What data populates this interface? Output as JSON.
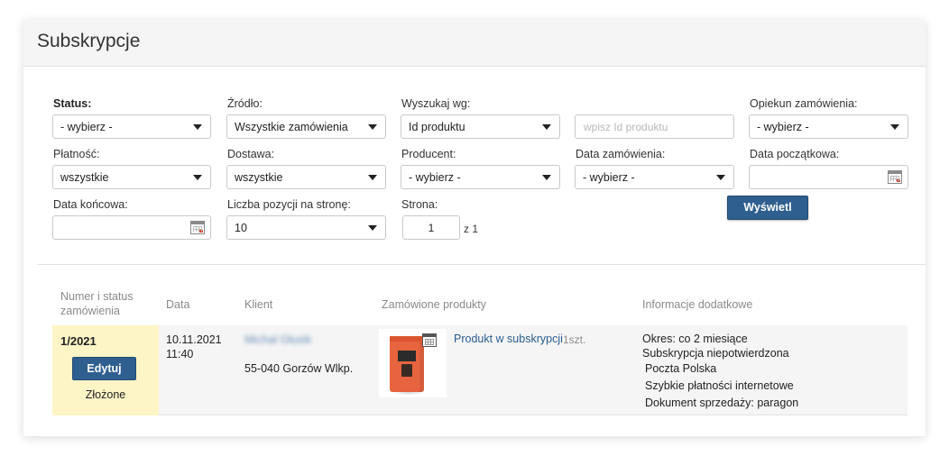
{
  "page": {
    "title": "Subskrypcje"
  },
  "filters": {
    "status": {
      "label": "Status:",
      "value": "- wybierz -"
    },
    "source": {
      "label": "Źródło:",
      "value": "Wszystkie zamówienia"
    },
    "search_by": {
      "label": "Wyszukaj wg:",
      "value": "Id produktu"
    },
    "search_input": {
      "placeholder": "wpisz Id produktu"
    },
    "order_manager": {
      "label": "Opiekun zamówienia:",
      "value": "- wybierz -"
    },
    "payment": {
      "label": "Płatność:",
      "value": "wszystkie"
    },
    "delivery": {
      "label": "Dostawa:",
      "value": "wszystkie"
    },
    "producer": {
      "label": "Producent:",
      "value": "- wybierz -"
    },
    "order_date": {
      "label": "Data zamówienia:",
      "value": "- wybierz -"
    },
    "start_date": {
      "label": "Data początkowa:",
      "value": ""
    },
    "end_date": {
      "label": "Data końcowa:",
      "value": ""
    },
    "per_page": {
      "label": "Liczba pozycji na stronę:",
      "value": "10"
    },
    "page": {
      "label": "Strona:",
      "value": "1",
      "of_text": "z 1"
    },
    "show_button": "Wyświetl"
  },
  "table": {
    "headers": {
      "order": "Numer i status zamówienia",
      "date": "Data",
      "client": "Klient",
      "products": "Zamówione produkty",
      "info": "Informacje dodatkowe"
    },
    "rows": [
      {
        "order_number": "1/2021",
        "edit_label": "Edytuj",
        "status": "Złożone",
        "date": "10.11.2021",
        "time": "11:40",
        "client_name": "Michał Głusik",
        "client_city": "55-040 Gorzów Wlkp.",
        "product_name": "Produkt w subskrypcji",
        "product_qty": "1szt.",
        "info": [
          "Okres: co 2 miesiące",
          "Subskrypcja niepotwierdzona",
          "Poczta Polska",
          "Szybkie płatności internetowe",
          "Dokument sprzedaży: paragon"
        ]
      }
    ]
  },
  "colors": {
    "primary_button": "#2f5f8f",
    "highlight_cell": "#fdf5c6",
    "link": "#2a5d8f",
    "product_bag": "#e8643f"
  }
}
